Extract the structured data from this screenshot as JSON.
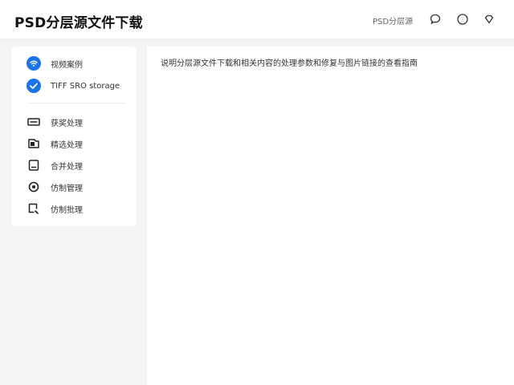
{
  "header": {
    "title": "PSD分层源文件下载",
    "link_label": "PSD分层源",
    "icons": [
      "chat-icon",
      "circle-icon",
      "diamond-icon"
    ]
  },
  "sidebar": {
    "primary": [
      {
        "label": "视频案例",
        "icon": "wifi-icon"
      },
      {
        "label": "TIFF SRO storage",
        "icon": "check-icon"
      }
    ],
    "secondary": [
      {
        "label": "获奖处理",
        "icon": "card-icon"
      },
      {
        "label": "精选处理",
        "icon": "folder-icon"
      },
      {
        "label": "合并处理",
        "icon": "document-icon"
      },
      {
        "label": "仿制管理",
        "icon": "target-icon"
      },
      {
        "label": "仿制批理",
        "icon": "crop-icon"
      }
    ]
  },
  "main": {
    "text": "说明分层源文件下载和相关内容的处理参数和修复与图片链接的查看指南"
  },
  "colors": {
    "accent": "#1a73e8",
    "background": "#f3f4f6",
    "panel": "#ffffff"
  }
}
